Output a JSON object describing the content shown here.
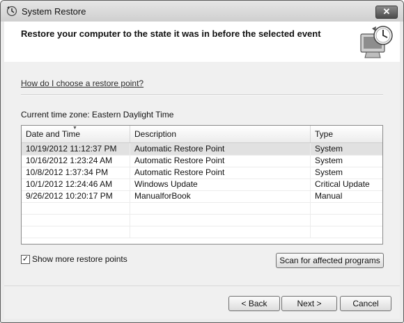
{
  "window": {
    "title": "System Restore",
    "close_symbol": "✕"
  },
  "header": {
    "text": "Restore your computer to the state it was in before the selected event"
  },
  "content": {
    "help_link": "How do I choose a restore point?",
    "timezone": "Current time zone: Eastern Daylight Time"
  },
  "table": {
    "columns": [
      "Date and Time",
      "Description",
      "Type"
    ],
    "sort_indicator": "▼",
    "rows": [
      {
        "date": "10/19/2012 11:12:37 PM",
        "description": "Automatic Restore Point",
        "type": "System"
      },
      {
        "date": "10/16/2012 1:23:24 AM",
        "description": "Automatic Restore Point",
        "type": "System"
      },
      {
        "date": "10/8/2012 1:37:34 PM",
        "description": "Automatic Restore Point",
        "type": "System"
      },
      {
        "date": "10/1/2012 12:24:46 AM",
        "description": "Windows Update",
        "type": "Critical Update"
      },
      {
        "date": "9/26/2012 10:20:17 PM",
        "description": "ManualforBook",
        "type": "Manual"
      }
    ]
  },
  "options": {
    "show_more_label": "Show more restore points",
    "show_more_checked": true,
    "checkmark": "✓"
  },
  "buttons": {
    "scan": "Scan for affected programs",
    "back": "< Back",
    "next": "Next >",
    "cancel": "Cancel"
  }
}
